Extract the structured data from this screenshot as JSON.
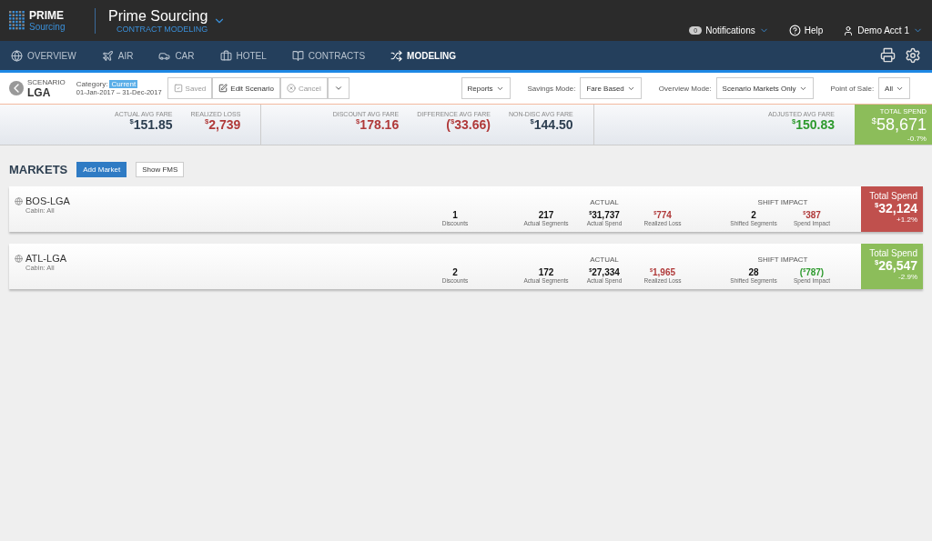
{
  "brand": {
    "logo_top": "PRIME",
    "logo_bottom": "Sourcing",
    "title": "Prime Sourcing",
    "subtitle": "CONTRACT MODELING"
  },
  "user_menu": {
    "notifications_count": "0",
    "notifications": "Notifications",
    "help": "Help",
    "account": "Demo Acct 1"
  },
  "nav": [
    {
      "label": "OVERVIEW",
      "selected": false
    },
    {
      "label": "AIR",
      "selected": false
    },
    {
      "label": "CAR",
      "selected": false
    },
    {
      "label": "HOTEL",
      "selected": false
    },
    {
      "label": "CONTRACTS",
      "selected": false
    },
    {
      "label": "MODELING",
      "selected": true
    }
  ],
  "scenario": {
    "caption": "SCENARIO",
    "name": "LGA",
    "category_label": "Category:",
    "category": "Current",
    "dates": "01-Jan-2017 – 31-Dec-2017"
  },
  "actions": [
    {
      "label": "Saved",
      "disabled": true
    },
    {
      "label": "Edit Scenario",
      "disabled": false
    },
    {
      "label": "Cancel",
      "disabled": true
    }
  ],
  "reports": "Reports",
  "filters": [
    {
      "label": "Savings Mode:",
      "value": "Fare Based"
    },
    {
      "label": "Overview Mode:",
      "value": "Scenario Markets Only"
    },
    {
      "label": "Point of Sale:",
      "value": "All"
    }
  ],
  "summary": [
    [
      {
        "label": "ACTUAL AVG FARE",
        "value": "$^{$}$151.85",
        "color": "#2c3e50"
      },
      {
        "label": "REALIZED LOSS",
        "value": "$^{$}$2,739",
        "color": "#b03a3a"
      }
    ],
    [
      {
        "label": "DISCOUNT AVG FARE",
        "value": "$^{$}$178.16",
        "color": "#b03a3a"
      },
      {
        "label": "DIFFERENCE AVG FARE",
        "value": "($^{$}$33.66)",
        "color": "#b03a3a"
      },
      {
        "label": "NON-DISC AVG FARE",
        "value": "$^{$}$144.50",
        "color": "#2c3e50"
      }
    ],
    [
      {
        "label": "ADJUSTED AVG FARE",
        "value": "$^{$}$150.83",
        "color": "#2e9a2e"
      }
    ]
  ],
  "total": {
    "label": "TOTAL SPEND",
    "value": "$^{$}$58,671",
    "change": "-0.7%",
    "color": "#8cbd5a"
  },
  "markets": {
    "title": "MARKETS",
    "add": "Add Market",
    "show": "Show FMS"
  },
  "market_rows": [
    {
      "name": "BOS-LGA",
      "cabin": "Cabin: All",
      "group_1": "ACTUAL",
      "group_2": "SHIFT IMPACT",
      "stats": [
        {
          "value": "1",
          "label": "Discounts",
          "color": "#111111"
        },
        {
          "value": "217",
          "label": "Actual Segments",
          "color": "#111111"
        },
        {
          "value": "$^{$}$31,737",
          "label": "Actual Spend",
          "color": "#111111"
        },
        {
          "value": "$^{$}$774",
          "label": "Realized Loss",
          "color": "#b03a3a"
        },
        {
          "value": "2",
          "label": "Shifted Segments",
          "color": "#111111"
        },
        {
          "value": "$^{$}$387",
          "label": "Spend Impact",
          "color": "#b03a3a"
        }
      ],
      "total_label": "Total Spend",
      "total": "$^{$}$32,124",
      "change": "+1.2%",
      "color": "#c0504d"
    },
    {
      "name": "ATL-LGA",
      "cabin": "Cabin: All",
      "group_1": "ACTUAL",
      "group_2": "SHIFT IMPACT",
      "stats": [
        {
          "value": "2",
          "label": "Discounts",
          "color": "#111111"
        },
        {
          "value": "172",
          "label": "Actual Segments",
          "color": "#111111"
        },
        {
          "value": "$^{$}$27,334",
          "label": "Actual Spend",
          "color": "#111111"
        },
        {
          "value": "$^{$}$1,965",
          "label": "Realized Loss",
          "color": "#b03a3a"
        },
        {
          "value": "28",
          "label": "Shifted Segments",
          "color": "#111111"
        },
        {
          "value": "($^{$}$787)",
          "label": "Spend Impact",
          "color": "#2e9a2e"
        }
      ],
      "total_label": "Total Spend",
      "total": "$^{$}$26,547",
      "change": "-2.9%",
      "color": "#8cbd5a"
    }
  ]
}
